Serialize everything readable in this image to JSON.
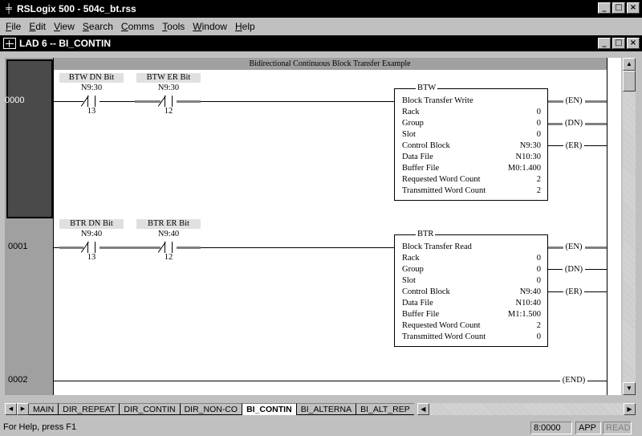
{
  "app": {
    "title": "RSLogix 500 - 504c_bt.rss",
    "icon": "ladder-app-icon"
  },
  "window_controls": {
    "minimize": "_",
    "maximize": "□",
    "close": "×"
  },
  "menu": [
    "File",
    "Edit",
    "View",
    "Search",
    "Comms",
    "Tools",
    "Window",
    "Help"
  ],
  "child_window": {
    "title": "LAD 6 -- BI_CONTIN"
  },
  "ladder": {
    "rung_comment": "Bidirectional Continuous Block Transfer Example",
    "rungs": [
      {
        "number": "0000",
        "contacts": [
          {
            "label": "BTW DN Bit",
            "address": "N9:30",
            "bit": "13"
          },
          {
            "label": "BTW ER Bit",
            "address": "N9:30",
            "bit": "12"
          }
        ],
        "box": {
          "header": "BTW",
          "title": "Block Transfer Write",
          "rows": [
            {
              "name": "Rack",
              "value": "0"
            },
            {
              "name": "Group",
              "value": "0"
            },
            {
              "name": "Slot",
              "value": "0"
            },
            {
              "name": "Control Block",
              "value": "N9:30"
            },
            {
              "name": "Data File",
              "value": "N10:30"
            },
            {
              "name": "Buffer File",
              "value": "M0:1.400"
            },
            {
              "name": "Requested Word Count",
              "value": "2"
            },
            {
              "name": "Transmitted Word Count",
              "value": "2"
            }
          ],
          "outputs": [
            "EN",
            "DN",
            "ER"
          ]
        }
      },
      {
        "number": "0001",
        "contacts": [
          {
            "label": "BTR DN Bit",
            "address": "N9:40",
            "bit": "13"
          },
          {
            "label": "BTR ER Bit",
            "address": "N9:40",
            "bit": "12"
          }
        ],
        "box": {
          "header": "BTR",
          "title": "Block Transfer Read",
          "rows": [
            {
              "name": "Rack",
              "value": "0"
            },
            {
              "name": "Group",
              "value": "0"
            },
            {
              "name": "Slot",
              "value": "0"
            },
            {
              "name": "Control Block",
              "value": "N9:40"
            },
            {
              "name": "Data File",
              "value": "N10:40"
            },
            {
              "name": "Buffer File",
              "value": "M1:1.500"
            },
            {
              "name": "Requested Word Count",
              "value": "2"
            },
            {
              "name": "Transmitted Word Count",
              "value": "0"
            }
          ],
          "outputs": [
            "EN",
            "DN",
            "ER"
          ]
        }
      },
      {
        "number": "0002",
        "end_label": "END"
      }
    ]
  },
  "tabs": {
    "items": [
      "MAIN",
      "DIR_REPEAT",
      "DIR_CONTIN",
      "DIR_NON-CO",
      "BI_CONTIN",
      "BI_ALTERNA",
      "BI_ALT_REP"
    ],
    "active": "BI_CONTIN"
  },
  "status": {
    "help": "For Help, press F1",
    "address": "8:0000",
    "mode": "APP",
    "read": "READ"
  },
  "colors": {
    "title_bar": "#000000",
    "rung_highlight": "#4a4a4a",
    "energized": "#808080"
  }
}
